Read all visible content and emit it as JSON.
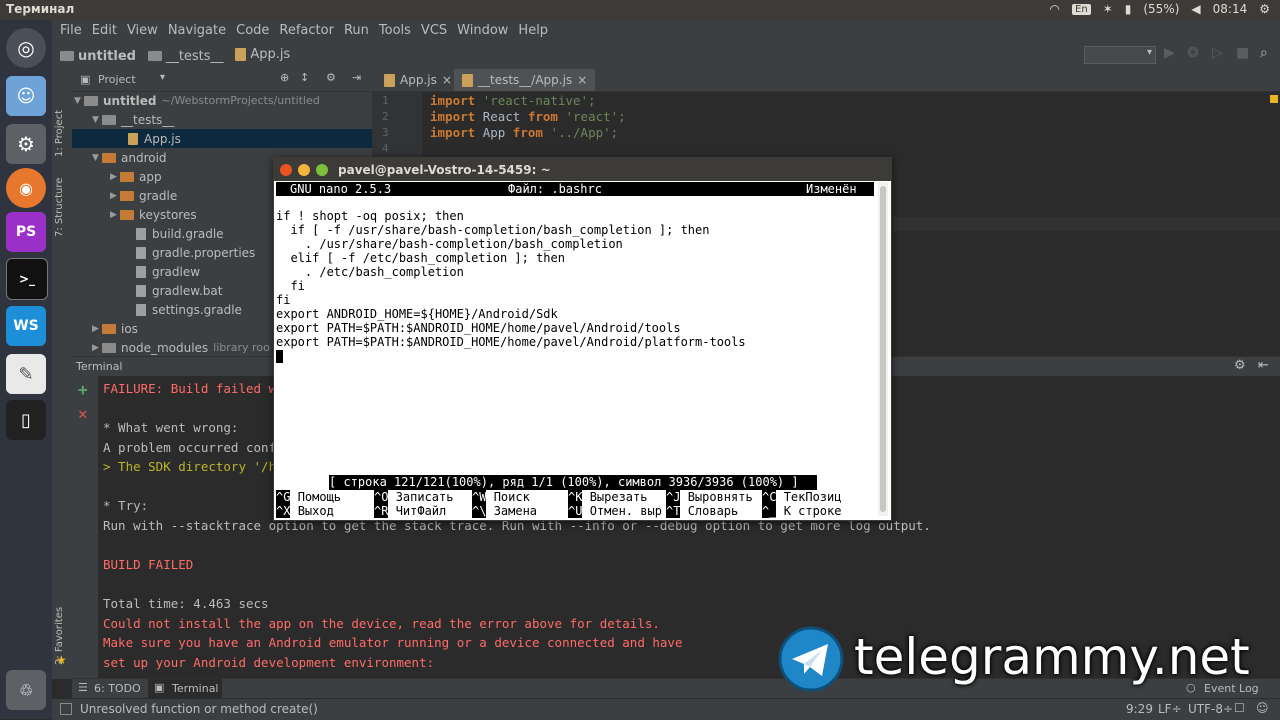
{
  "topbar": {
    "title": "Терминал",
    "lang": "En",
    "battery": "(55%)",
    "time": "08:14"
  },
  "menubar": {
    "items": [
      "File",
      "Edit",
      "View",
      "Navigate",
      "Code",
      "Refactor",
      "Run",
      "Tools",
      "VCS",
      "Window",
      "Help"
    ]
  },
  "navbar": {
    "crumbs": [
      "untitled",
      "__tests__",
      "App.js"
    ]
  },
  "sidetabs": {
    "project": "1: Project",
    "structure": "7: Structure",
    "favorites": "2: Favorites"
  },
  "project": {
    "header": "Project",
    "rows": [
      {
        "name": "untitled",
        "suffix": "~/WebstormProjects/untitled"
      },
      {
        "name": "__tests__"
      },
      {
        "name": "App.js"
      },
      {
        "name": "android"
      },
      {
        "name": "app"
      },
      {
        "name": "gradle"
      },
      {
        "name": "keystores"
      },
      {
        "name": "build.gradle"
      },
      {
        "name": "gradle.properties"
      },
      {
        "name": "gradlew"
      },
      {
        "name": "gradlew.bat"
      },
      {
        "name": "settings.gradle"
      },
      {
        "name": "ios"
      },
      {
        "name": "node_modules",
        "suffix": "library roo"
      }
    ]
  },
  "editor": {
    "tabs": [
      "App.js",
      "__tests__/App.js"
    ],
    "lines": [
      "1",
      "2",
      "3",
      "4"
    ],
    "code": {
      "l1_kw": "import",
      "l1_str": "'react-native';",
      "l2_kw": "import",
      "l2_id": "React",
      "l2_from": "from",
      "l2_str": "'react';",
      "l3_kw": "import",
      "l3_id": "App",
      "l3_from": "from",
      "l3_str": "'../App';"
    }
  },
  "terminal": {
    "header": "Terminal",
    "lines": [
      "FAILURE: Build failed w",
      "* What went wrong:",
      "A problem occurred conf",
      "> The SDK directory '/h",
      "* Try:",
      "Run with --stacktrace option to get the stack trace. Run with --info or --debug option to get more log output.",
      "BUILD FAILED",
      "Total time: 4.463 secs",
      "Could not install the app on the device, read the error above for details.",
      "Make sure you have an Android emulator running or a device connected and have",
      "set up your Android development environment:"
    ]
  },
  "bottomtabs": {
    "todo": "6: TODO",
    "terminal": "Terminal",
    "eventlog": "Event Log"
  },
  "status": {
    "message": "Unresolved function or method create()",
    "position": "9:29",
    "lineend": "LF÷",
    "encoding": "UTF-8÷"
  },
  "nano": {
    "title": "pavel@pavel-Vostro-14-5459: ~",
    "version": "GNU nano 2.5.3",
    "file": "Файл: .bashrc",
    "modified": "Изменён",
    "lines": [
      "if ! shopt -oq posix; then",
      "  if [ -f /usr/share/bash-completion/bash_completion ]; then",
      "    . /usr/share/bash-completion/bash_completion",
      "  elif [ -f /etc/bash_completion ]; then",
      "    . /etc/bash_completion",
      "  fi",
      "fi",
      "export ANDROID_HOME=${HOME}/Android/Sdk",
      "export PATH=$PATH:$ANDROID_HOME/home/pavel/Android/tools",
      "export PATH=$PATH:$ANDROID_HOME/home/pavel/Android/platform-tools"
    ],
    "statusline": "[ строка 121/121(100%), ряд 1/1 (100%), символ 3936/3936 (100%) ]",
    "shortcuts": [
      {
        "key": "^G",
        "label": "Помощь"
      },
      {
        "key": "^O",
        "label": "Записать"
      },
      {
        "key": "^W",
        "label": "Поиск"
      },
      {
        "key": "^K",
        "label": "Вырезать"
      },
      {
        "key": "^J",
        "label": "Выровнять"
      },
      {
        "key": "^C",
        "label": "ТекПозиц"
      },
      {
        "key": "^X",
        "label": "Выход"
      },
      {
        "key": "^R",
        "label": "ЧитФайл"
      },
      {
        "key": "^\\",
        "label": "Замена"
      },
      {
        "key": "^U",
        "label": "Отмен. выр"
      },
      {
        "key": "^T",
        "label": "Словарь"
      },
      {
        "key": "^_",
        "label": "К строке"
      }
    ]
  },
  "watermark": {
    "text": "telegrammy.net"
  },
  "launcher": {
    "ps": "PS",
    "ws": "WS"
  }
}
